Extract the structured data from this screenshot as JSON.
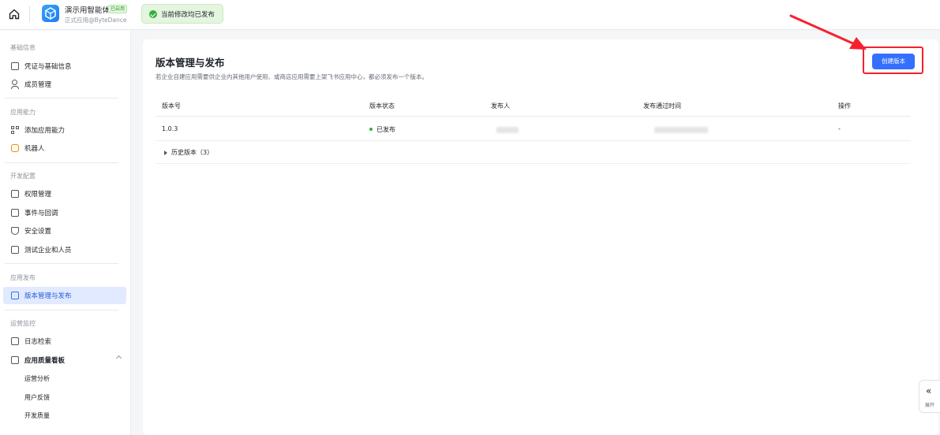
{
  "topbar": {
    "app_name": "演示用智能体",
    "app_status_tag": "已启用",
    "app_subtitle": "正式应用@ByteDance",
    "notice_text": "当前修改均已发布"
  },
  "sidebar": {
    "sections": [
      {
        "title": "基础信息",
        "items": [
          "凭证与基础信息",
          "成员管理"
        ]
      },
      {
        "title": "应用能力",
        "items": [
          "添加应用能力",
          "机器人"
        ]
      },
      {
        "title": "开发配置",
        "items": [
          "权限管理",
          "事件与回调",
          "安全设置",
          "测试企业和人员"
        ]
      },
      {
        "title": "应用发布",
        "items": [
          "版本管理与发布"
        ]
      },
      {
        "title": "运营监控",
        "items": [
          "日志检索",
          "应用质量看板"
        ]
      }
    ],
    "sub_items": [
      "运营分析",
      "用户反馈",
      "开发质量"
    ],
    "active_item": "版本管理与发布"
  },
  "main": {
    "title": "版本管理与发布",
    "description": "若企业自建应用需要供企业内其他用户使用、或商店应用需要上架飞书应用中心，都必须发布一个版本。",
    "create_button": "创建版本",
    "table": {
      "columns": [
        "版本号",
        "版本状态",
        "发布人",
        "发布通过时间",
        "操作"
      ],
      "rows": [
        {
          "version": "1.0.3",
          "status": "已发布",
          "operation": "-"
        }
      ]
    },
    "history_label": "历史版本（3）"
  },
  "expand": {
    "label": "展开"
  },
  "colors": {
    "primary": "#3370ff",
    "success": "#34b13a",
    "annotation": "#f5222d",
    "active_bg": "#e1eaff"
  },
  "icons": {
    "home": "home-icon",
    "app_logo": "app-logo-icon",
    "notice": "check-circle-icon",
    "expand": "double-chevron-left-icon"
  }
}
